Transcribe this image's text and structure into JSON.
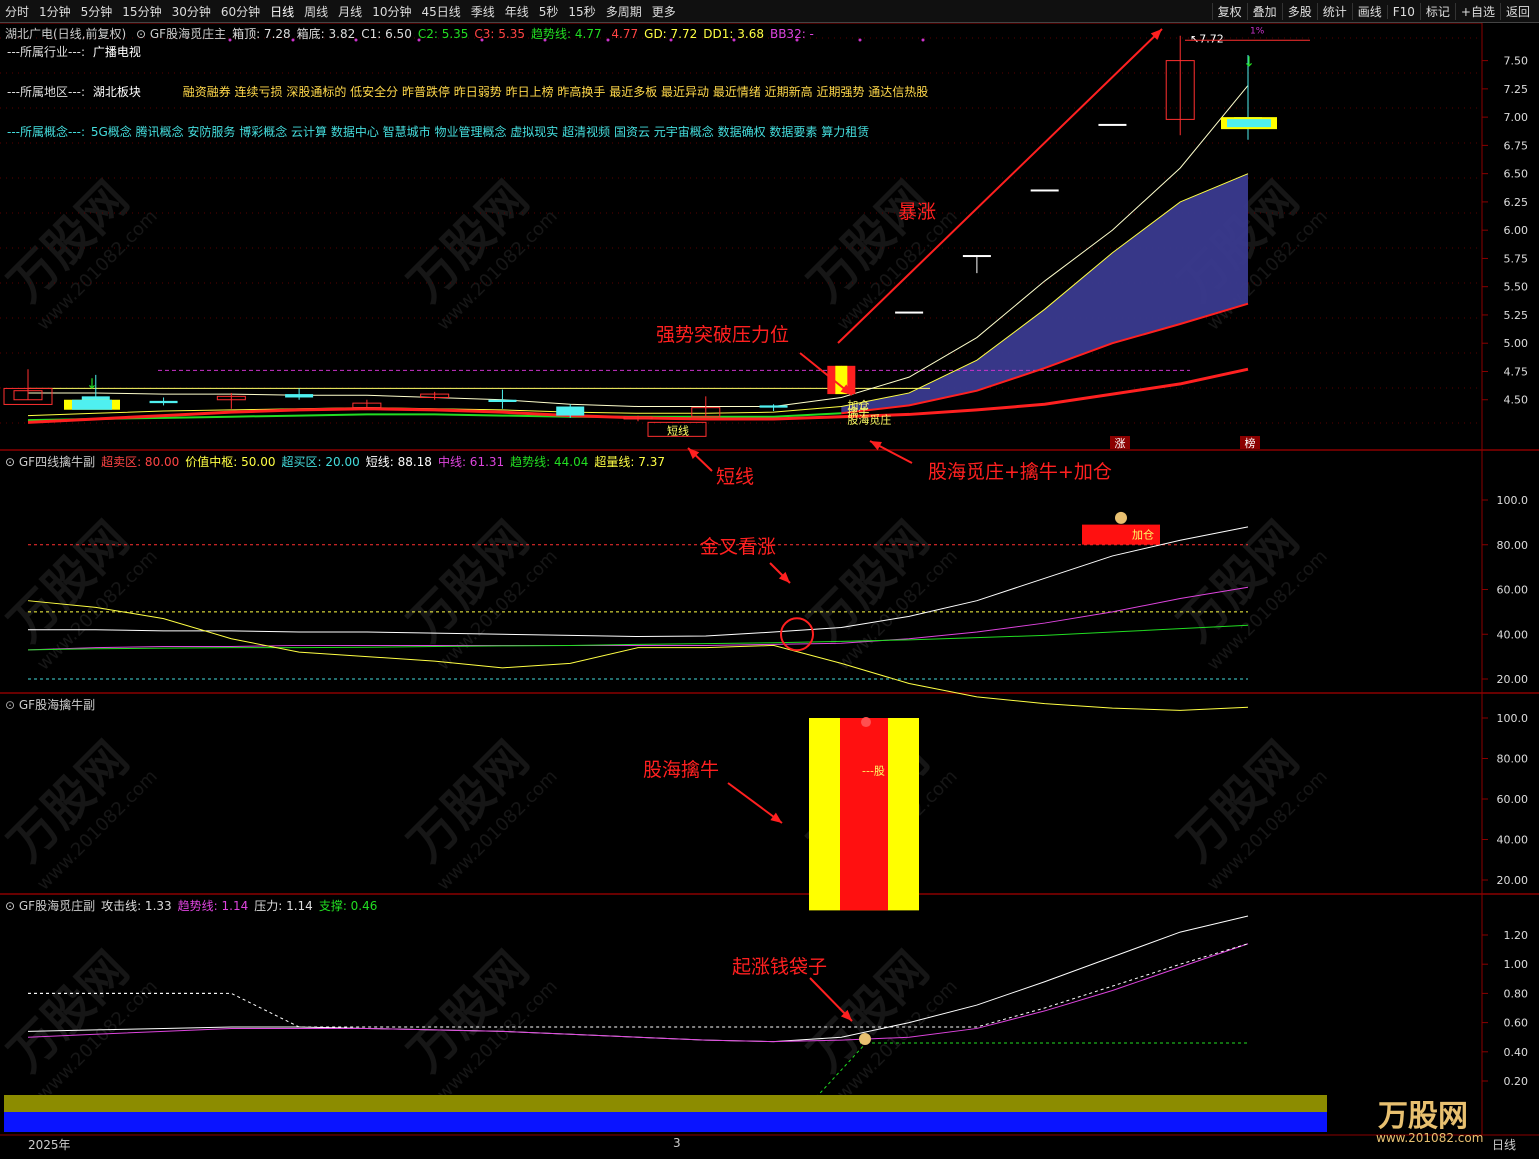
{
  "toolbar": {
    "timeframes": [
      "分时",
      "1分钟",
      "5分钟",
      "15分钟",
      "30分钟",
      "60分钟",
      "日线",
      "周线",
      "月线",
      "10分钟",
      "45日线",
      "季线",
      "年线",
      "5秒",
      "15秒",
      "多周期",
      "更多"
    ],
    "active": "日线",
    "right_buttons": [
      "复权",
      "叠加",
      "多股",
      "统计",
      "画线",
      "F10",
      "标记",
      "+自选",
      "返回"
    ]
  },
  "main_header": {
    "stock": "湖北广电(日线,前复权)",
    "indicator": "GF股海觅庄主",
    "items": [
      {
        "k": "箱顶:",
        "v": "7.28",
        "c": "#dddddd"
      },
      {
        "k": "箱底:",
        "v": "3.82",
        "c": "#dddddd"
      },
      {
        "k": "C1:",
        "v": "6.50",
        "c": "#dddddd"
      },
      {
        "k": "C2:",
        "v": "5.35",
        "c": "#22dd22"
      },
      {
        "k": "C3:",
        "v": "5.35",
        "c": "#ff4444"
      },
      {
        "k": "趋势线:",
        "v": "4.77",
        "c": "#22dd22"
      },
      {
        "k": "",
        "v": "4.77",
        "c": "#ff4444"
      },
      {
        "k": "GD:",
        "v": "7.72",
        "c": "#ffff44"
      },
      {
        "k": "DD1:",
        "v": "3.68",
        "c": "#ffff44"
      },
      {
        "k": "BB32:",
        "v": "-",
        "c": "#dd44dd"
      }
    ]
  },
  "info": {
    "industry_label": "---所属行业---:",
    "industry": "广播电视",
    "region_label": "---所属地区---:",
    "region": "湖北板块",
    "region_tags": "融资融券 连续亏损 深股通标的 低安全分 昨普跌停 昨日弱势 昨日上榜 昨高换手 最近多板 最近异动 最近情绪 近期新高 近期强势 通达信热股",
    "concept_label": "---所属概念---:",
    "concepts": "5G概念 腾讯概念 安防服务 博彩概念 云计算 数据中心 智慧城市 物业管理概念 虚拟现实 超清视频 国资云 元宇宙概念 数据确权 数据要素 算力租赁"
  },
  "annotations": {
    "surge": "暴涨",
    "breakout": "强势突破压力位",
    "short_line": "短线",
    "combo": "股海觅庄+擒牛+加仓",
    "golden_cross": "金叉看涨",
    "catch_bull": "股海擒牛",
    "money_bag": "起涨钱袋子"
  },
  "candle_labels": {
    "add": "加仓",
    "catch": "擒牛",
    "find": "股海觅庄",
    "short": "短线",
    "peak": "7.72",
    "zhang": "涨",
    "bang": "榜",
    "tiny": "1%"
  },
  "panel2": {
    "title": "GF四线擒牛副",
    "items": [
      {
        "k": "超卖区:",
        "v": "80.00",
        "c": "#ff4444"
      },
      {
        "k": "价值中枢:",
        "v": "50.00",
        "c": "#ffff44"
      },
      {
        "k": "超买区:",
        "v": "20.00",
        "c": "#44dddd"
      },
      {
        "k": "短线:",
        "v": "88.18",
        "c": "#ffffff"
      },
      {
        "k": "中线:",
        "v": "61.31",
        "c": "#dd44dd"
      },
      {
        "k": "趋势线:",
        "v": "44.04",
        "c": "#22dd22"
      },
      {
        "k": "超量线:",
        "v": "7.37",
        "c": "#ffff44"
      }
    ],
    "add_label": "加仓"
  },
  "panel3": {
    "title": "GF股海擒牛副",
    "bar_label": "---股"
  },
  "panel4": {
    "title": "GF股海觅庄副",
    "items": [
      {
        "k": "攻击线:",
        "v": "1.33",
        "c": "#dddddd"
      },
      {
        "k": "趋势线:",
        "v": "1.14",
        "c": "#dd44dd"
      },
      {
        "k": "压力:",
        "v": "1.14",
        "c": "#dddddd"
      },
      {
        "k": "支撑:",
        "v": "0.46",
        "c": "#22dd22"
      }
    ]
  },
  "xaxis": {
    "year": "2025年",
    "month": "3",
    "right": "日线"
  },
  "axes": {
    "main": [
      "7.50",
      "7.25",
      "7.00",
      "6.75",
      "6.50",
      "6.25",
      "6.00",
      "5.75",
      "5.50",
      "5.25",
      "5.00",
      "4.75",
      "4.50"
    ],
    "p2": [
      "100.0",
      "80.00",
      "60.00",
      "40.00",
      "20.00"
    ],
    "p3": [
      "100.0",
      "80.00",
      "60.00",
      "40.00",
      "20.00"
    ],
    "p4": [
      "1.20",
      "1.00",
      "0.80",
      "0.60",
      "0.40",
      "0.20"
    ]
  },
  "watermark": {
    "brand": "万股网",
    "url": "www.201082.com"
  },
  "chart_data": [
    {
      "type": "candlestick",
      "title": "湖北广电(日线,前复权)",
      "ylim": [
        4.25,
        7.7
      ],
      "candles": [
        {
          "o": 4.5,
          "c": 4.58,
          "h": 4.77,
          "l": 4.5,
          "color": "red"
        },
        {
          "o": 4.48,
          "c": 4.53,
          "h": 4.72,
          "l": 4.46,
          "color": "cyan"
        },
        {
          "o": 4.47,
          "c": 4.49,
          "h": 4.52,
          "l": 4.45,
          "color": "cyan"
        },
        {
          "o": 4.5,
          "c": 4.53,
          "h": 4.56,
          "l": 4.42,
          "color": "red"
        },
        {
          "o": 4.52,
          "c": 4.55,
          "h": 4.6,
          "l": 4.5,
          "color": "cyan"
        },
        {
          "o": 4.47,
          "c": 4.43,
          "h": 4.5,
          "l": 4.43,
          "color": "red"
        },
        {
          "o": 4.52,
          "c": 4.55,
          "h": 4.57,
          "l": 4.5,
          "color": "red"
        },
        {
          "o": 4.5,
          "c": 4.48,
          "h": 4.59,
          "l": 4.42,
          "color": "cyan"
        },
        {
          "o": 4.44,
          "c": 4.36,
          "h": 4.46,
          "l": 4.34,
          "color": "cyan"
        },
        {
          "o": 4.33,
          "c": 4.35,
          "h": 4.36,
          "l": 4.31,
          "color": "red"
        },
        {
          "o": 4.35,
          "c": 4.43,
          "h": 4.53,
          "l": 4.35,
          "color": "red"
        },
        {
          "o": 4.43,
          "c": 4.45,
          "h": 4.46,
          "l": 4.4,
          "color": "cyan"
        },
        {
          "o": 4.55,
          "c": 4.8,
          "h": 4.8,
          "l": 4.55,
          "color": "red"
        },
        {
          "o": 5.28,
          "c": 5.28,
          "h": 5.28,
          "l": 5.28,
          "color": "white"
        },
        {
          "o": 5.78,
          "c": 5.78,
          "h": 5.78,
          "l": 5.62,
          "color": "white"
        },
        {
          "o": 6.36,
          "c": 6.36,
          "h": 6.36,
          "l": 6.36,
          "color": "white"
        },
        {
          "o": 6.94,
          "c": 6.94,
          "h": 6.94,
          "l": 6.94,
          "color": "white"
        },
        {
          "o": 7.5,
          "c": 6.98,
          "h": 7.72,
          "l": 6.84,
          "color": "red"
        },
        {
          "o": 7.0,
          "c": 6.95,
          "h": 7.55,
          "l": 6.8,
          "color": "cyan"
        }
      ],
      "series": [
        {
          "name": "趋势线",
          "values": [
            4.3,
            4.33,
            4.36,
            4.39,
            4.41,
            4.42,
            4.41,
            4.39,
            4.36,
            4.34,
            4.33,
            4.33,
            4.35,
            4.37,
            4.41,
            4.46,
            4.55,
            4.64,
            4.77
          ]
        },
        {
          "name": "GD",
          "values": [
            4.56,
            4.56,
            4.55,
            4.55,
            4.54,
            4.54,
            4.52,
            4.5,
            4.46,
            4.44,
            4.44,
            4.44,
            4.52,
            4.7,
            5.05,
            5.55,
            6.0,
            6.55,
            7.28
          ]
        },
        {
          "name": "C1",
          "values": [
            4.36,
            4.38,
            4.4,
            4.41,
            4.42,
            4.43,
            4.42,
            4.41,
            4.39,
            4.38,
            4.38,
            4.39,
            4.44,
            4.56,
            4.85,
            5.3,
            5.8,
            6.25,
            6.5
          ]
        },
        {
          "name": "C2",
          "values": [
            4.32,
            4.33,
            4.34,
            4.35,
            4.36,
            4.37,
            4.37,
            4.36,
            4.35,
            4.35,
            4.35,
            4.35,
            4.38,
            4.45,
            4.58,
            4.78,
            5.0,
            5.17,
            5.35
          ]
        }
      ],
      "ref_line": 4.76
    },
    {
      "type": "line",
      "title": "GF四线擒牛副",
      "ylim": [
        10,
        110
      ],
      "ref_lines": [
        80,
        50,
        20
      ],
      "series": [
        {
          "name": "短线",
          "values": [
            42,
            42,
            41.5,
            41.5,
            41,
            41,
            40.5,
            40,
            39.5,
            39,
            39.2,
            41,
            43,
            48,
            55,
            65,
            75,
            82,
            88
          ]
        },
        {
          "name": "中线",
          "values": [
            33,
            34,
            34.5,
            34.5,
            35,
            35,
            35,
            35,
            35,
            35,
            35,
            35.5,
            36,
            38,
            41,
            45,
            50,
            56,
            61
          ]
        },
        {
          "name": "趋势线",
          "values": [
            33,
            33.5,
            33.8,
            34,
            34,
            34.2,
            34.5,
            34.8,
            35,
            35.5,
            35.8,
            36.2,
            36.8,
            37.5,
            38.5,
            39.5,
            41,
            42.5,
            44
          ]
        },
        {
          "name": "超量线",
          "values": [
            55,
            52,
            47,
            38,
            32,
            30,
            28,
            25,
            27,
            34,
            34,
            35,
            27,
            18,
            12,
            9,
            7,
            6,
            7.4
          ]
        }
      ]
    },
    {
      "type": "bar",
      "title": "GF股海擒牛副",
      "ylim": [
        0,
        100
      ],
      "values": [
        100
      ]
    },
    {
      "type": "line",
      "title": "GF股海觅庄副",
      "ylim": [
        0.2,
        1.3
      ],
      "ref_lines": [
        0.46,
        0.57
      ],
      "series": [
        {
          "name": "攻击线",
          "values": [
            0.54,
            0.55,
            0.56,
            0.57,
            0.57,
            0.56,
            0.55,
            0.54,
            0.52,
            0.5,
            0.48,
            0.47,
            0.5,
            0.6,
            0.72,
            0.88,
            1.05,
            1.22,
            1.33
          ]
        },
        {
          "name": "趋势线",
          "values": [
            0.5,
            0.52,
            0.54,
            0.56,
            0.56,
            0.56,
            0.55,
            0.54,
            0.52,
            0.5,
            0.48,
            0.47,
            0.48,
            0.5,
            0.56,
            0.68,
            0.82,
            0.98,
            1.14
          ]
        },
        {
          "name": "压力",
          "values": [
            0.8,
            0.8,
            0.8,
            0.8,
            0.57,
            0.57,
            0.57,
            0.57,
            0.57,
            0.57,
            0.57,
            0.57,
            0.57,
            0.57,
            0.57,
            0.7,
            0.85,
            1.0,
            1.14
          ]
        }
      ]
    }
  ],
  "colors": {
    "up": "#ff3030",
    "cyan": "#4ff0f0",
    "grid": "#8b0000",
    "band": "#3a3a8f"
  }
}
